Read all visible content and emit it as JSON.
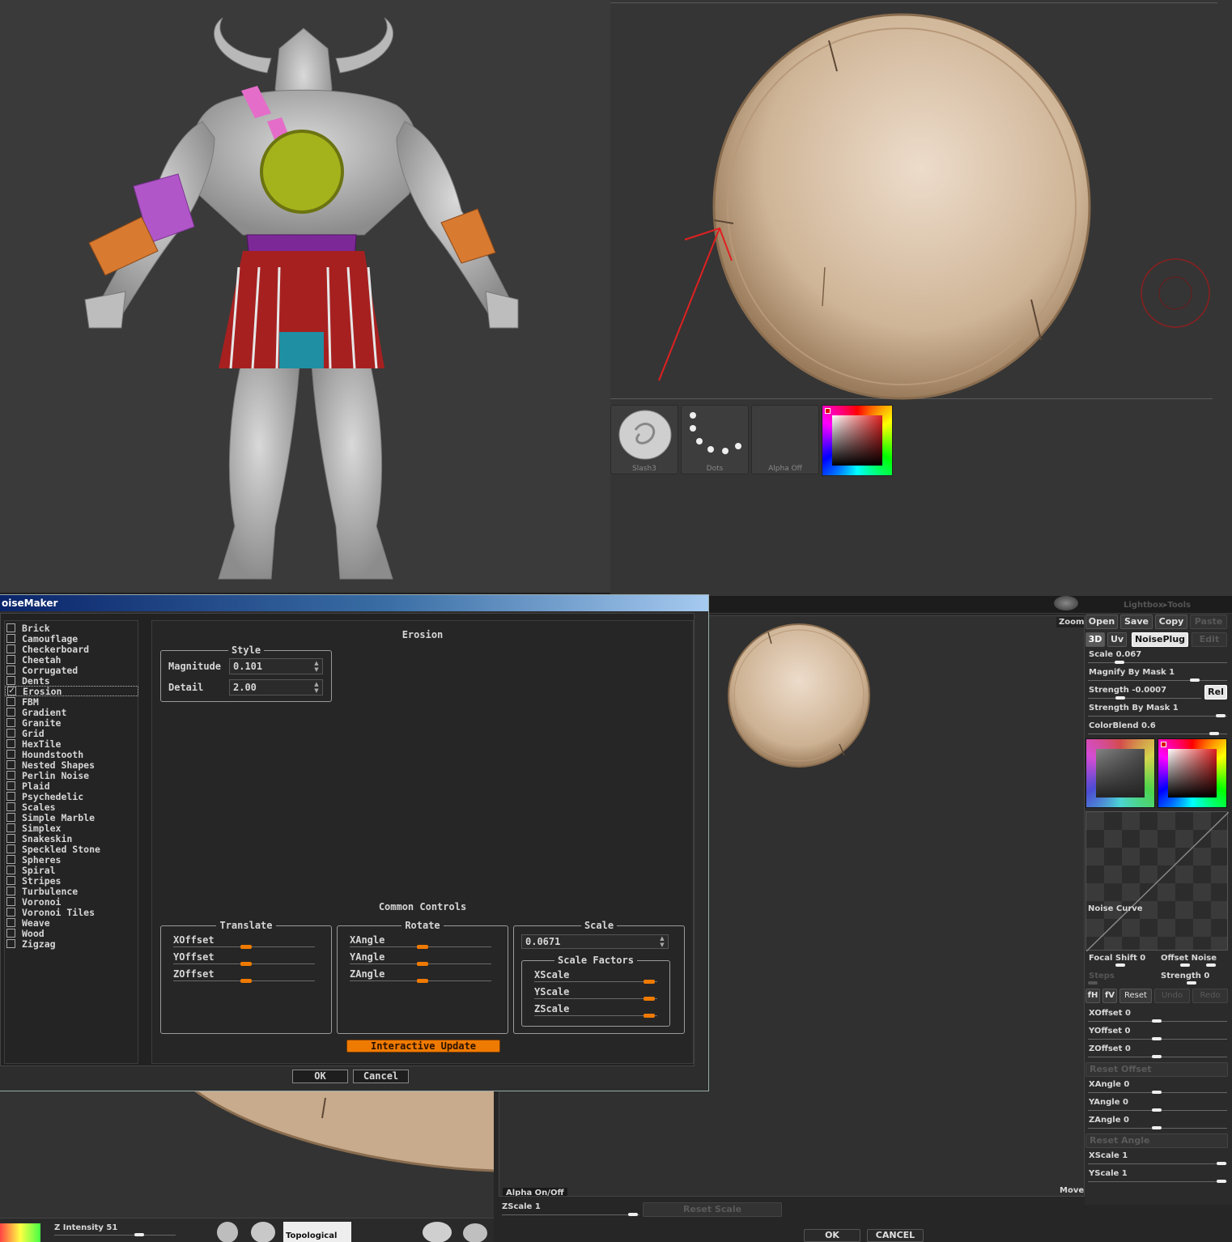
{
  "viewport_top_right": {
    "thumbs": [
      {
        "label": "Slash3"
      },
      {
        "label": "Dots"
      },
      {
        "label": "Alpha Off"
      }
    ]
  },
  "zbrush_editor": {
    "topbar": {
      "lightbox": "Lightbox▸Tools"
    },
    "canvas": {
      "zoom": "Zoom",
      "move": "Move",
      "alpha_toggle": "Alpha On/Off"
    },
    "file_buttons": {
      "open": "Open",
      "save": "Save",
      "copy": "Copy",
      "paste": "Paste"
    },
    "mode_buttons": {
      "3d": "3D",
      "uv": "Uv",
      "noiseplug": "NoisePlug",
      "edit": "Edit"
    },
    "params": {
      "scale": "Scale 0.067",
      "magnify_by_mask": "Magnify By Mask 1",
      "strength": "Strength -0.0007",
      "rel": "Rel",
      "strength_by_mask": "Strength By Mask 1",
      "colorblend": "ColorBlend 0.6"
    },
    "noise_curve": "Noise Curve",
    "curve_controls": {
      "focal_shift": "Focal Shift 0",
      "offset_noise": "Offset Noise",
      "steps": "Steps",
      "strength": "Strength 0",
      "fh": "fH",
      "fv": "fV",
      "reset": "Reset",
      "undo": "Undo",
      "redo": "Redo"
    },
    "offsets": {
      "x": "XOffset 0",
      "y": "YOffset 0",
      "z": "ZOffset 0",
      "reset": "Reset Offset"
    },
    "angles": {
      "x": "XAngle 0",
      "y": "YAngle 0",
      "z": "ZAngle 0",
      "reset": "Reset Angle"
    },
    "scales": {
      "x": "XScale 1",
      "y": "YScale 1",
      "z": "ZScale 1",
      "reset": "Reset Scale"
    },
    "footer": {
      "ok": "OK",
      "cancel": "CANCEL"
    }
  },
  "bottom_left": {
    "z_intensity": "Z Intensity 51",
    "material": "Topological"
  },
  "noisemaker": {
    "title": "oiseMaker",
    "list": [
      "Brick",
      "Camouflage",
      "Checkerboard",
      "Cheetah",
      "Corrugated",
      "Dents",
      "Erosion",
      "FBM",
      "Gradient",
      "Granite",
      "Grid",
      "HexTile",
      "Houndstooth",
      "Nested Shapes",
      "Perlin Noise",
      "Plaid",
      "Psychedelic",
      "Scales",
      "Simple Marble",
      "Simplex",
      "Snakeskin",
      "Speckled Stone",
      "Spheres",
      "Spiral",
      "Stripes",
      "Turbulence",
      "Voronoi",
      "Voronoi Tiles",
      "Weave",
      "Wood",
      "Zigzag"
    ],
    "checked": "Erosion",
    "panel_title": "Erosion",
    "style": {
      "title": "Style",
      "magnitude_label": "Magnitude",
      "magnitude": "0.101",
      "detail_label": "Detail",
      "detail": "2.00"
    },
    "common_title": "Common Controls",
    "translate": {
      "title": "Translate",
      "x": "XOffset",
      "y": "YOffset",
      "z": "ZOffset"
    },
    "rotate": {
      "title": "Rotate",
      "x": "XAngle",
      "y": "YAngle",
      "z": "ZAngle"
    },
    "scale": {
      "title": "Scale",
      "value": "0.0671",
      "factors_title": "Scale Factors",
      "x": "XScale",
      "y": "YScale",
      "z": "ZScale"
    },
    "interactive_update": "Interactive Update",
    "ok": "OK",
    "cancel": "Cancel"
  },
  "colors": {
    "accent_orange": "#ef7a00",
    "viewport_bg": "#3a3a3a",
    "skin": "#c4a888"
  }
}
